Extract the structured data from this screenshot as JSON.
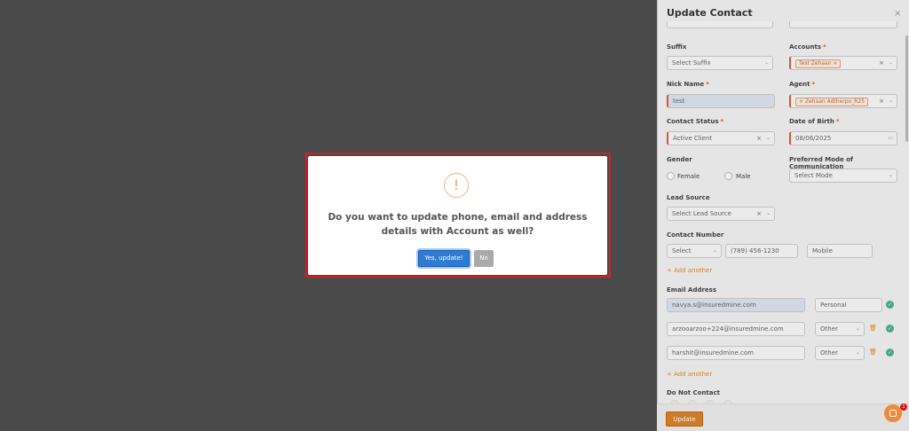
{
  "modal": {
    "icon": "!",
    "question": "Do you want to update phone, email and address details with Account as well?",
    "yes_label": "Yes, update!",
    "no_label": "No"
  },
  "panel": {
    "title": "Update Contact",
    "close": "×",
    "suffix": {
      "label": "Suffix",
      "placeholder": "Select Suffix"
    },
    "accounts": {
      "label": "Accounts",
      "tag": "Test Zehaan"
    },
    "nick_name": {
      "label": "Nick Name",
      "value": "test"
    },
    "agent": {
      "label": "Agent",
      "tag": "Zehaan Adtherpo_R25"
    },
    "contact_status": {
      "label": "Contact Status",
      "value": "Active Client"
    },
    "dob": {
      "label": "Date of Birth",
      "value": "08/06/2025"
    },
    "gender": {
      "label": "Gender",
      "options": [
        "Female",
        "Male"
      ]
    },
    "mode": {
      "label": "Preferred Mode of Communication",
      "placeholder": "Select Mode"
    },
    "lead_source": {
      "label": "Lead Source",
      "placeholder": "Select Lead Source"
    },
    "contact_number": {
      "label": "Contact Number",
      "code": "Select",
      "phone": "(789) 456-1230",
      "type": "Mobile"
    },
    "add_another": "+ Add another",
    "email": {
      "label": "Email Address",
      "rows": [
        {
          "email": "navya.s@insuredmine.com",
          "type": "Personal"
        },
        {
          "email": "arzooarzoo+224@insuredmine.com",
          "type": "Other"
        },
        {
          "email": "harshit@insuredmine.com",
          "type": "Other"
        }
      ]
    },
    "do_not_contact": "Do Not Contact",
    "update_label": "Update"
  },
  "chat_badge": "1"
}
